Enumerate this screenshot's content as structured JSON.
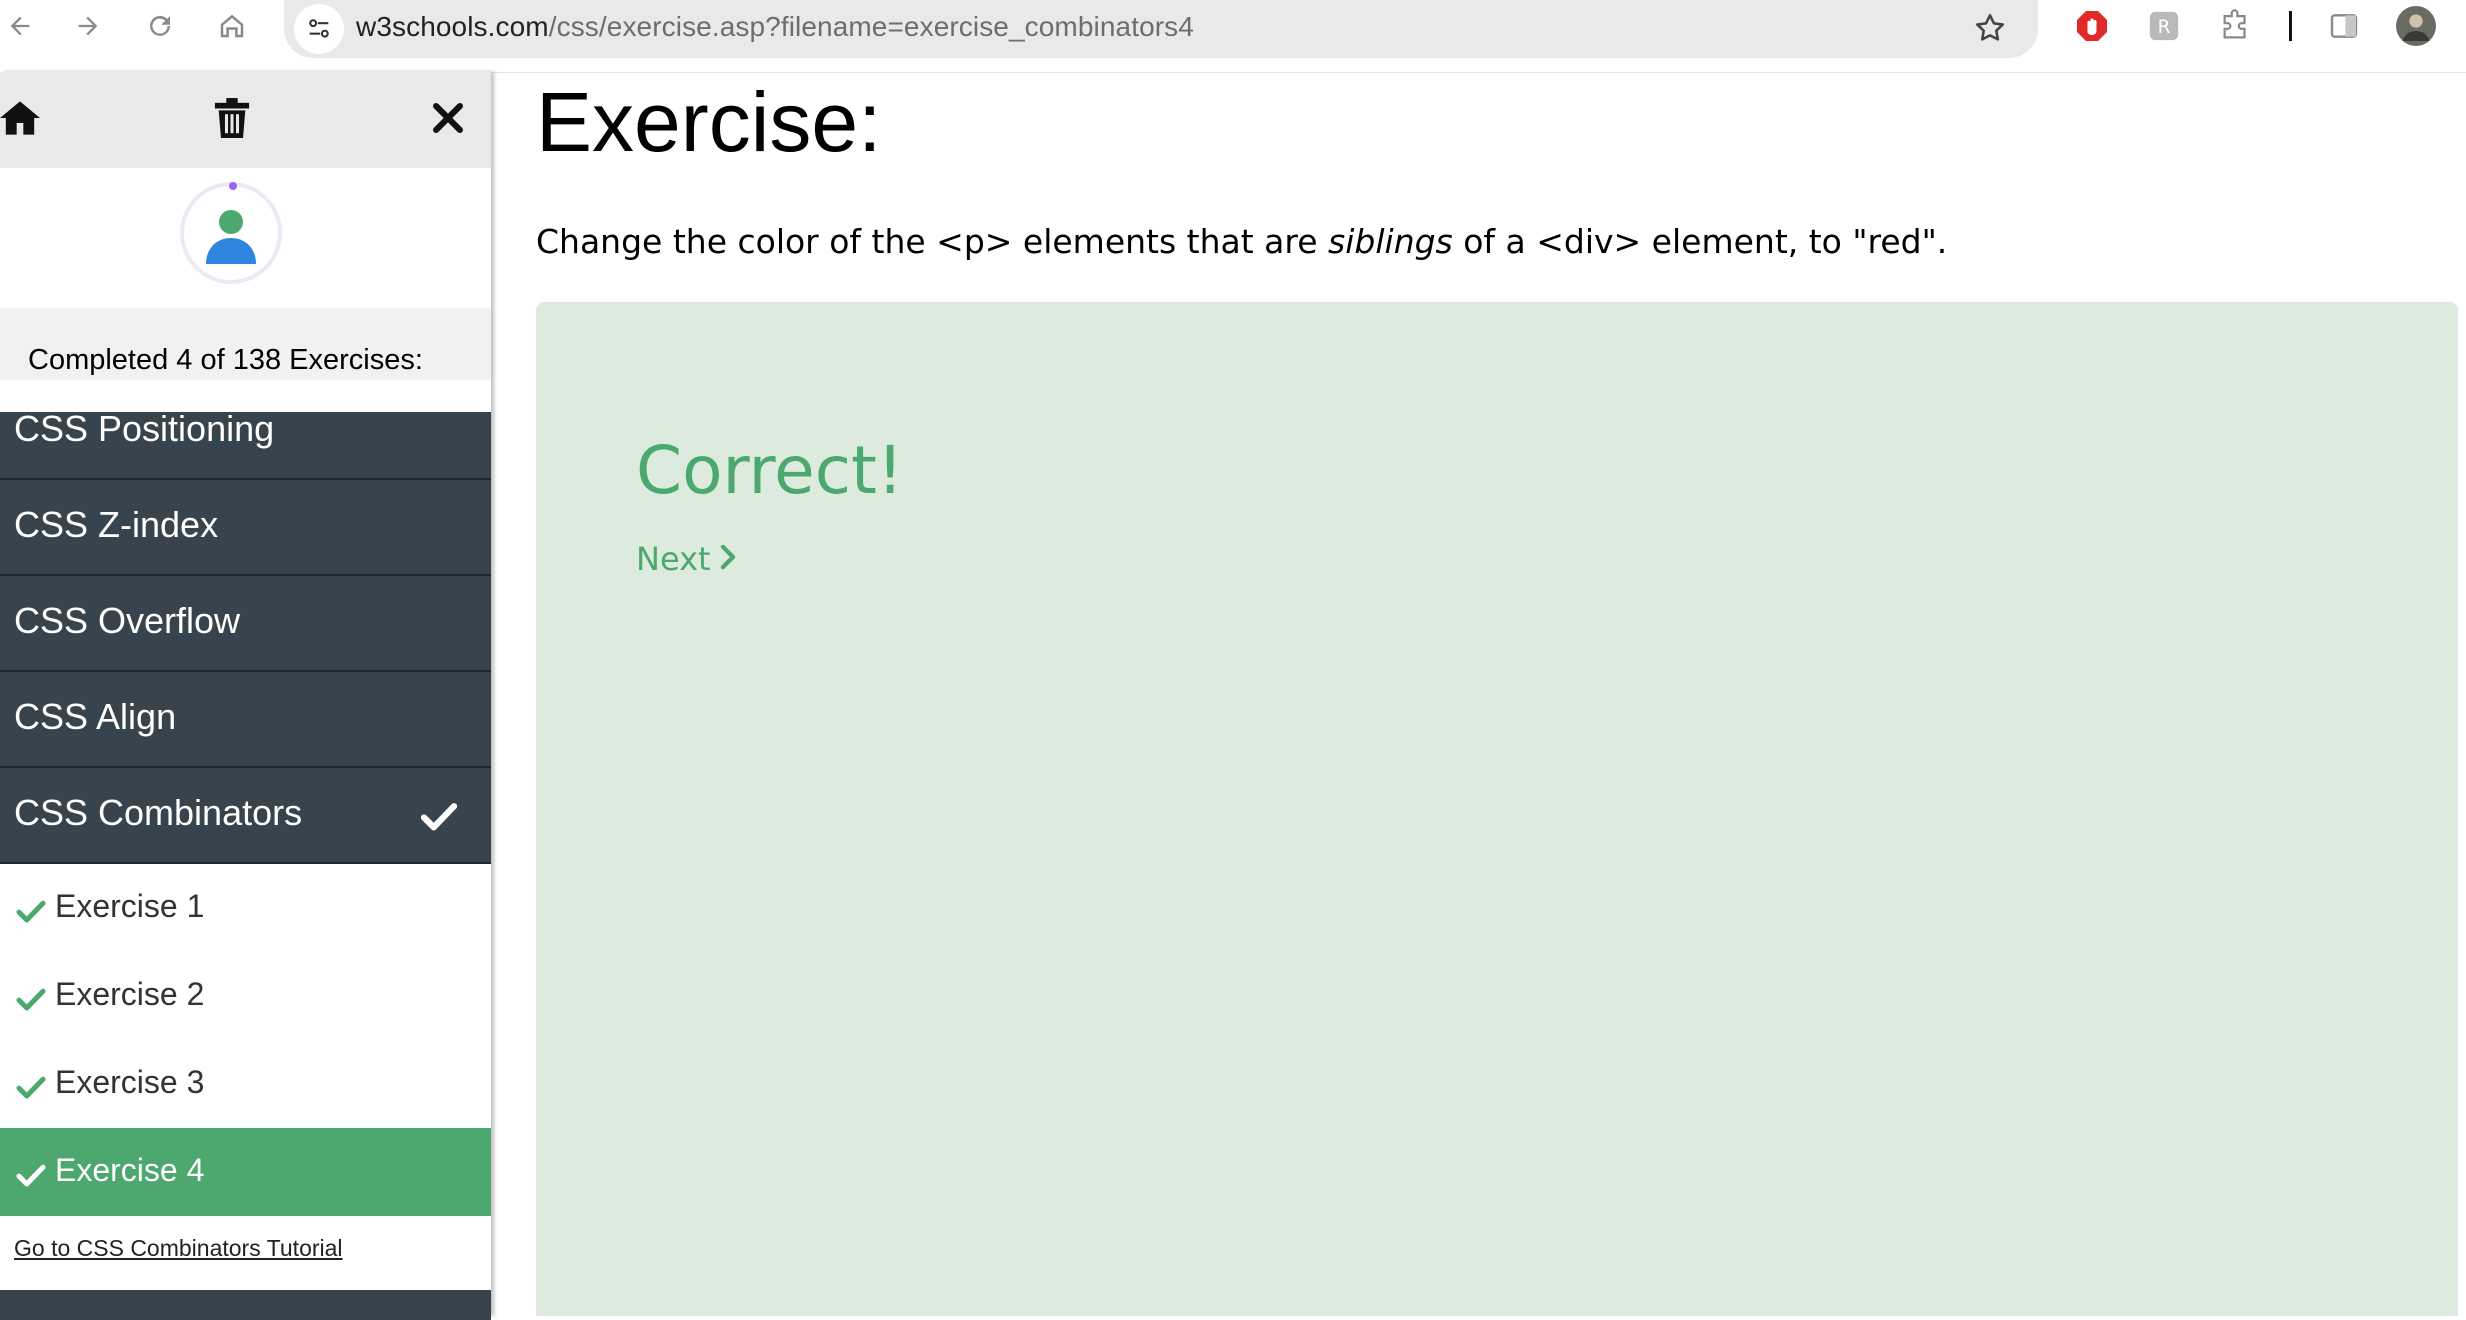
{
  "browser": {
    "url_host": "w3schools.com",
    "url_path": "/css/exercise.asp?filename=exercise_combinators4",
    "icons": [
      "back-icon",
      "forward-icon",
      "reload-icon",
      "home-icon",
      "site-settings-icon",
      "bookmark-star-icon",
      "adblock-extension-icon",
      "extension-icon",
      "puzzle-extensions-icon",
      "side-panel-icon",
      "profile-avatar-icon"
    ]
  },
  "sidebar": {
    "completed_text": "Completed 4 of 138 Exercises:",
    "menu": [
      {
        "label": "CSS Positioning"
      },
      {
        "label": "CSS Z-index"
      },
      {
        "label": "CSS Overflow"
      },
      {
        "label": "CSS Align"
      },
      {
        "label": "CSS Combinators"
      }
    ],
    "exercises": [
      {
        "label": "Exercise 1"
      },
      {
        "label": "Exercise 2"
      },
      {
        "label": "Exercise 3"
      },
      {
        "label": "Exercise 4"
      }
    ],
    "tutorial_link": "Go to CSS Combinators Tutorial"
  },
  "main": {
    "title": "Exercise:",
    "instruction_pre": "Change the color of the <p> elements that are ",
    "instruction_em": "siblings",
    "instruction_post": " of a <div> element, to \"red\".",
    "result_title": "Correct!",
    "next_label": "Next"
  },
  "colors": {
    "accent_green": "#4ca86e",
    "sidebar_dark": "#38444d",
    "panel_bg": "#ddebdf"
  }
}
